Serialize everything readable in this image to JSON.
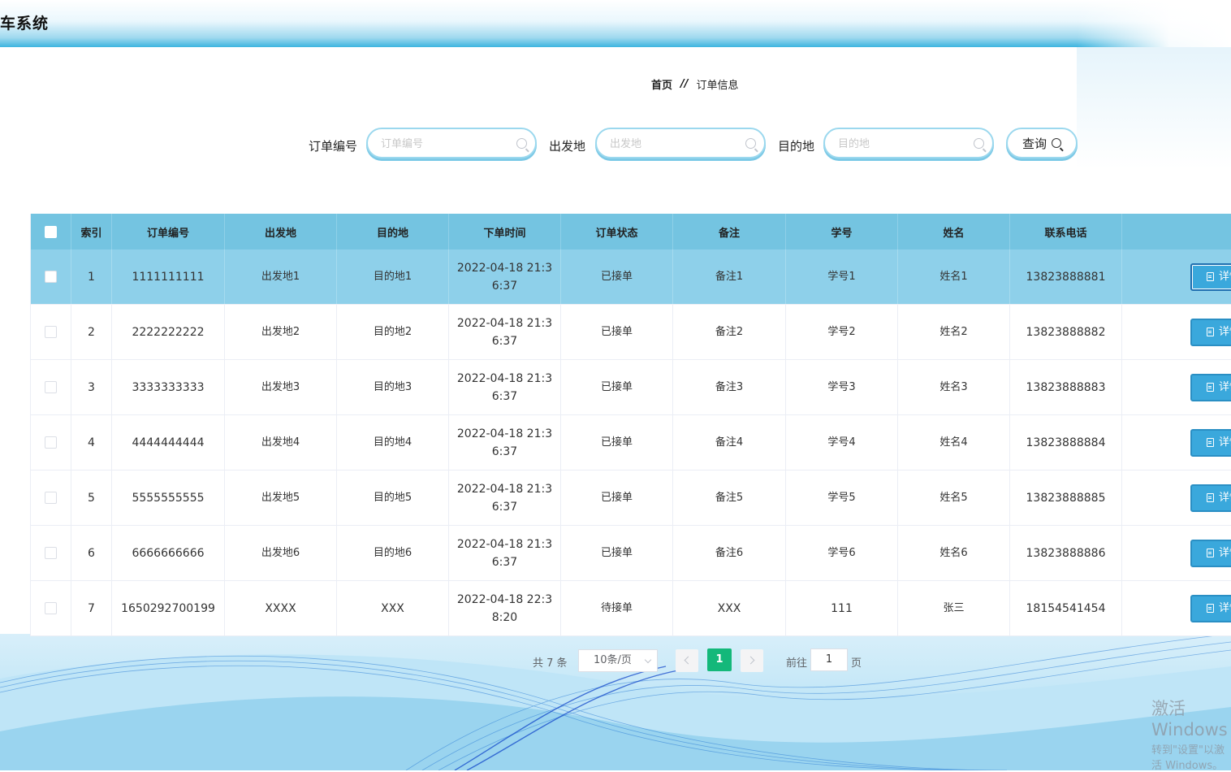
{
  "app": {
    "title": "车系统"
  },
  "breadcrumb": {
    "home": "首页",
    "separator": "//",
    "current": "订单信息"
  },
  "search": {
    "order_no": {
      "label": "订单编号",
      "placeholder": "订单编号"
    },
    "origin": {
      "label": "出发地",
      "placeholder": "出发地"
    },
    "destination": {
      "label": "目的地",
      "placeholder": "目的地"
    },
    "query_label": "查询"
  },
  "table": {
    "headers": [
      "索引",
      "订单编号",
      "出发地",
      "目的地",
      "下单时间",
      "订单状态",
      "备注",
      "学号",
      "姓名",
      "联系电话",
      ""
    ],
    "detail_label": "详情",
    "rows": [
      {
        "index": "1",
        "order_no": "1111111111",
        "origin": "出发地1",
        "destination": "目的地1",
        "time_a": "2022-04-18 21:3",
        "time_b": "6:37",
        "status": "已接单",
        "remark": "备注1",
        "student_no": "学号1",
        "name": "姓名1",
        "phone": "13823888881"
      },
      {
        "index": "2",
        "order_no": "2222222222",
        "origin": "出发地2",
        "destination": "目的地2",
        "time_a": "2022-04-18 21:3",
        "time_b": "6:37",
        "status": "已接单",
        "remark": "备注2",
        "student_no": "学号2",
        "name": "姓名2",
        "phone": "13823888882"
      },
      {
        "index": "3",
        "order_no": "3333333333",
        "origin": "出发地3",
        "destination": "目的地3",
        "time_a": "2022-04-18 21:3",
        "time_b": "6:37",
        "status": "已接单",
        "remark": "备注3",
        "student_no": "学号3",
        "name": "姓名3",
        "phone": "13823888883"
      },
      {
        "index": "4",
        "order_no": "4444444444",
        "origin": "出发地4",
        "destination": "目的地4",
        "time_a": "2022-04-18 21:3",
        "time_b": "6:37",
        "status": "已接单",
        "remark": "备注4",
        "student_no": "学号4",
        "name": "姓名4",
        "phone": "13823888884"
      },
      {
        "index": "5",
        "order_no": "5555555555",
        "origin": "出发地5",
        "destination": "目的地5",
        "time_a": "2022-04-18 21:3",
        "time_b": "6:37",
        "status": "已接单",
        "remark": "备注5",
        "student_no": "学号5",
        "name": "姓名5",
        "phone": "13823888885"
      },
      {
        "index": "6",
        "order_no": "6666666666",
        "origin": "出发地6",
        "destination": "目的地6",
        "time_a": "2022-04-18 21:3",
        "time_b": "6:37",
        "status": "已接单",
        "remark": "备注6",
        "student_no": "学号6",
        "name": "姓名6",
        "phone": "13823888886"
      },
      {
        "index": "7",
        "order_no": "1650292700199",
        "origin": "XXXX",
        "destination": "XXX",
        "time_a": "2022-04-18 22:3",
        "time_b": "8:20",
        "status": "待接单",
        "remark": "XXX",
        "student_no": "111",
        "name": "张三",
        "phone": "18154541454"
      }
    ]
  },
  "pagination": {
    "total": "共 7 条",
    "page_size": "10条/页",
    "current": "1",
    "goto_label": "前往",
    "goto_value": "1",
    "goto_unit": "页"
  },
  "watermark": {
    "line1": "激活 Windows",
    "line2": "转到\"设置\"以激活 Windows。"
  },
  "colors": {
    "header_accent": "#3cb4df",
    "table_header": "#74c4e1",
    "highlight_row": "#8ed0ea",
    "detail_button": "#3aa8dc",
    "current_page": "#14b87a"
  }
}
